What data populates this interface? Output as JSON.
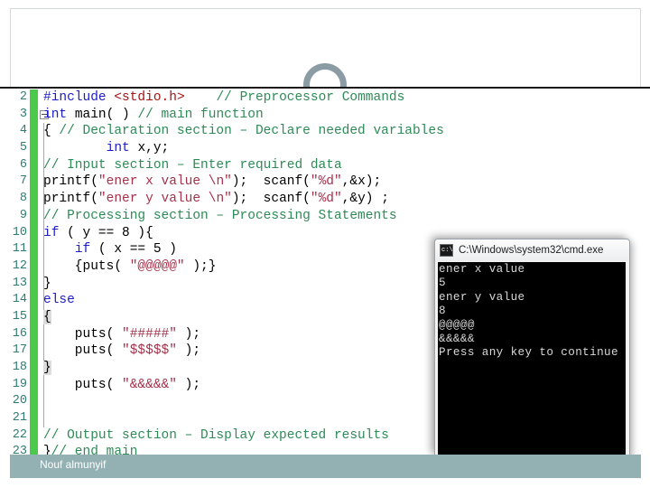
{
  "slide": {
    "footer_name": "Nouf almunyif",
    "deco_icon": "circle-arc-decoration"
  },
  "editor": {
    "title": "c-source-code-editor",
    "first_line_number": 2,
    "lines": [
      {
        "num": "2",
        "fold": false,
        "tokens": [
          {
            "cls": "t-pre",
            "text": "#include "
          },
          {
            "cls": "t-inc",
            "text": "<stdio.h>"
          },
          {
            "cls": "t-plain",
            "text": "    "
          },
          {
            "cls": "t-cmt",
            "text": "// Preprocessor Commands"
          }
        ]
      },
      {
        "num": "3",
        "fold": true,
        "tokens": [
          {
            "cls": "t-kw",
            "text": "int "
          },
          {
            "cls": "t-plain",
            "text": "main( ) "
          },
          {
            "cls": "t-cmt",
            "text": "// main function"
          }
        ]
      },
      {
        "num": "4",
        "fold": false,
        "tokens": [
          {
            "cls": "t-plain",
            "text": "{ "
          },
          {
            "cls": "t-cmt",
            "text": "// Declaration section – Declare needed variables"
          }
        ]
      },
      {
        "num": "5",
        "fold": false,
        "tokens": [
          {
            "cls": "t-plain",
            "text": "        "
          },
          {
            "cls": "t-kw",
            "text": "int "
          },
          {
            "cls": "t-plain",
            "text": "x,y;"
          }
        ]
      },
      {
        "num": "6",
        "fold": false,
        "tokens": [
          {
            "cls": "t-cmt",
            "text": "// Input section – Enter required data"
          }
        ]
      },
      {
        "num": "7",
        "fold": false,
        "tokens": [
          {
            "cls": "t-plain",
            "text": "printf("
          },
          {
            "cls": "t-str",
            "text": "\"ener x value \\n\""
          },
          {
            "cls": "t-plain",
            "text": ");  scanf("
          },
          {
            "cls": "t-str",
            "text": "\"%d\""
          },
          {
            "cls": "t-plain",
            "text": ",&x);"
          }
        ]
      },
      {
        "num": "8",
        "fold": false,
        "tokens": [
          {
            "cls": "t-plain",
            "text": "printf("
          },
          {
            "cls": "t-str",
            "text": "\"ener y value \\n\""
          },
          {
            "cls": "t-plain",
            "text": ");  scanf("
          },
          {
            "cls": "t-str",
            "text": "\"%d\""
          },
          {
            "cls": "t-plain",
            "text": ",&y) ;"
          }
        ]
      },
      {
        "num": "9",
        "fold": false,
        "tokens": [
          {
            "cls": "t-cmt",
            "text": "// Processing section – Processing Statements"
          }
        ]
      },
      {
        "num": "10",
        "fold": false,
        "tokens": [
          {
            "cls": "t-kw",
            "text": "if"
          },
          {
            "cls": "t-plain",
            "text": " ( y == 8 ){"
          }
        ]
      },
      {
        "num": "11",
        "fold": false,
        "tokens": [
          {
            "cls": "t-plain",
            "text": "    "
          },
          {
            "cls": "t-kw",
            "text": "if"
          },
          {
            "cls": "t-plain",
            "text": " ( x == 5 )"
          }
        ]
      },
      {
        "num": "12",
        "fold": false,
        "tokens": [
          {
            "cls": "t-plain",
            "text": "    {puts( "
          },
          {
            "cls": "t-str",
            "text": "\"@@@@@\""
          },
          {
            "cls": "t-plain",
            "text": " );}"
          }
        ]
      },
      {
        "num": "13",
        "fold": false,
        "tokens": [
          {
            "cls": "t-plain",
            "text": "}"
          }
        ]
      },
      {
        "num": "14",
        "fold": false,
        "tokens": [
          {
            "cls": "t-kw",
            "text": "else"
          }
        ]
      },
      {
        "num": "15",
        "fold": false,
        "tokens": [
          {
            "cls": "t-brace-hl",
            "text": "{"
          }
        ]
      },
      {
        "num": "16",
        "fold": false,
        "tokens": [
          {
            "cls": "t-plain",
            "text": "    puts( "
          },
          {
            "cls": "t-str",
            "text": "\"#####\""
          },
          {
            "cls": "t-plain",
            "text": " );"
          }
        ]
      },
      {
        "num": "17",
        "fold": false,
        "tokens": [
          {
            "cls": "t-plain",
            "text": "    puts( "
          },
          {
            "cls": "t-str",
            "text": "\"$$$$$\""
          },
          {
            "cls": "t-plain",
            "text": " );"
          }
        ]
      },
      {
        "num": "18",
        "fold": false,
        "tokens": [
          {
            "cls": "t-brace-hl",
            "text": "}"
          }
        ]
      },
      {
        "num": "19",
        "fold": false,
        "tokens": [
          {
            "cls": "t-plain",
            "text": "    puts( "
          },
          {
            "cls": "t-str",
            "text": "\"&&&&&\""
          },
          {
            "cls": "t-plain",
            "text": " );"
          }
        ]
      },
      {
        "num": "20",
        "fold": false,
        "tokens": []
      },
      {
        "num": "21",
        "fold": false,
        "tokens": []
      },
      {
        "num": "22",
        "fold": false,
        "tokens": [
          {
            "cls": "t-cmt",
            "text": "// Output section – Display expected results"
          }
        ]
      },
      {
        "num": "23",
        "fold": false,
        "tokens": [
          {
            "cls": "t-plain",
            "text": "}"
          },
          {
            "cls": "t-cmt",
            "text": "// end main"
          }
        ]
      }
    ]
  },
  "console": {
    "title": "C:\\Windows\\system32\\cmd.exe",
    "icon": "cmd-icon",
    "output_lines": [
      "ener x value",
      "5",
      "ener y value",
      "8",
      "@@@@@",
      "&&&&&",
      "Press any key to continue"
    ]
  },
  "colors": {
    "keyword": "#1c1ccc",
    "comment": "#2e8b57",
    "string": "#a5314a",
    "include": "#a31515",
    "gutter_number": "#2e7d74",
    "change_bar": "#4bc94b",
    "footer_bar": "#93b0b2",
    "console_background": "#000000",
    "console_text": "#d8d8d8"
  }
}
